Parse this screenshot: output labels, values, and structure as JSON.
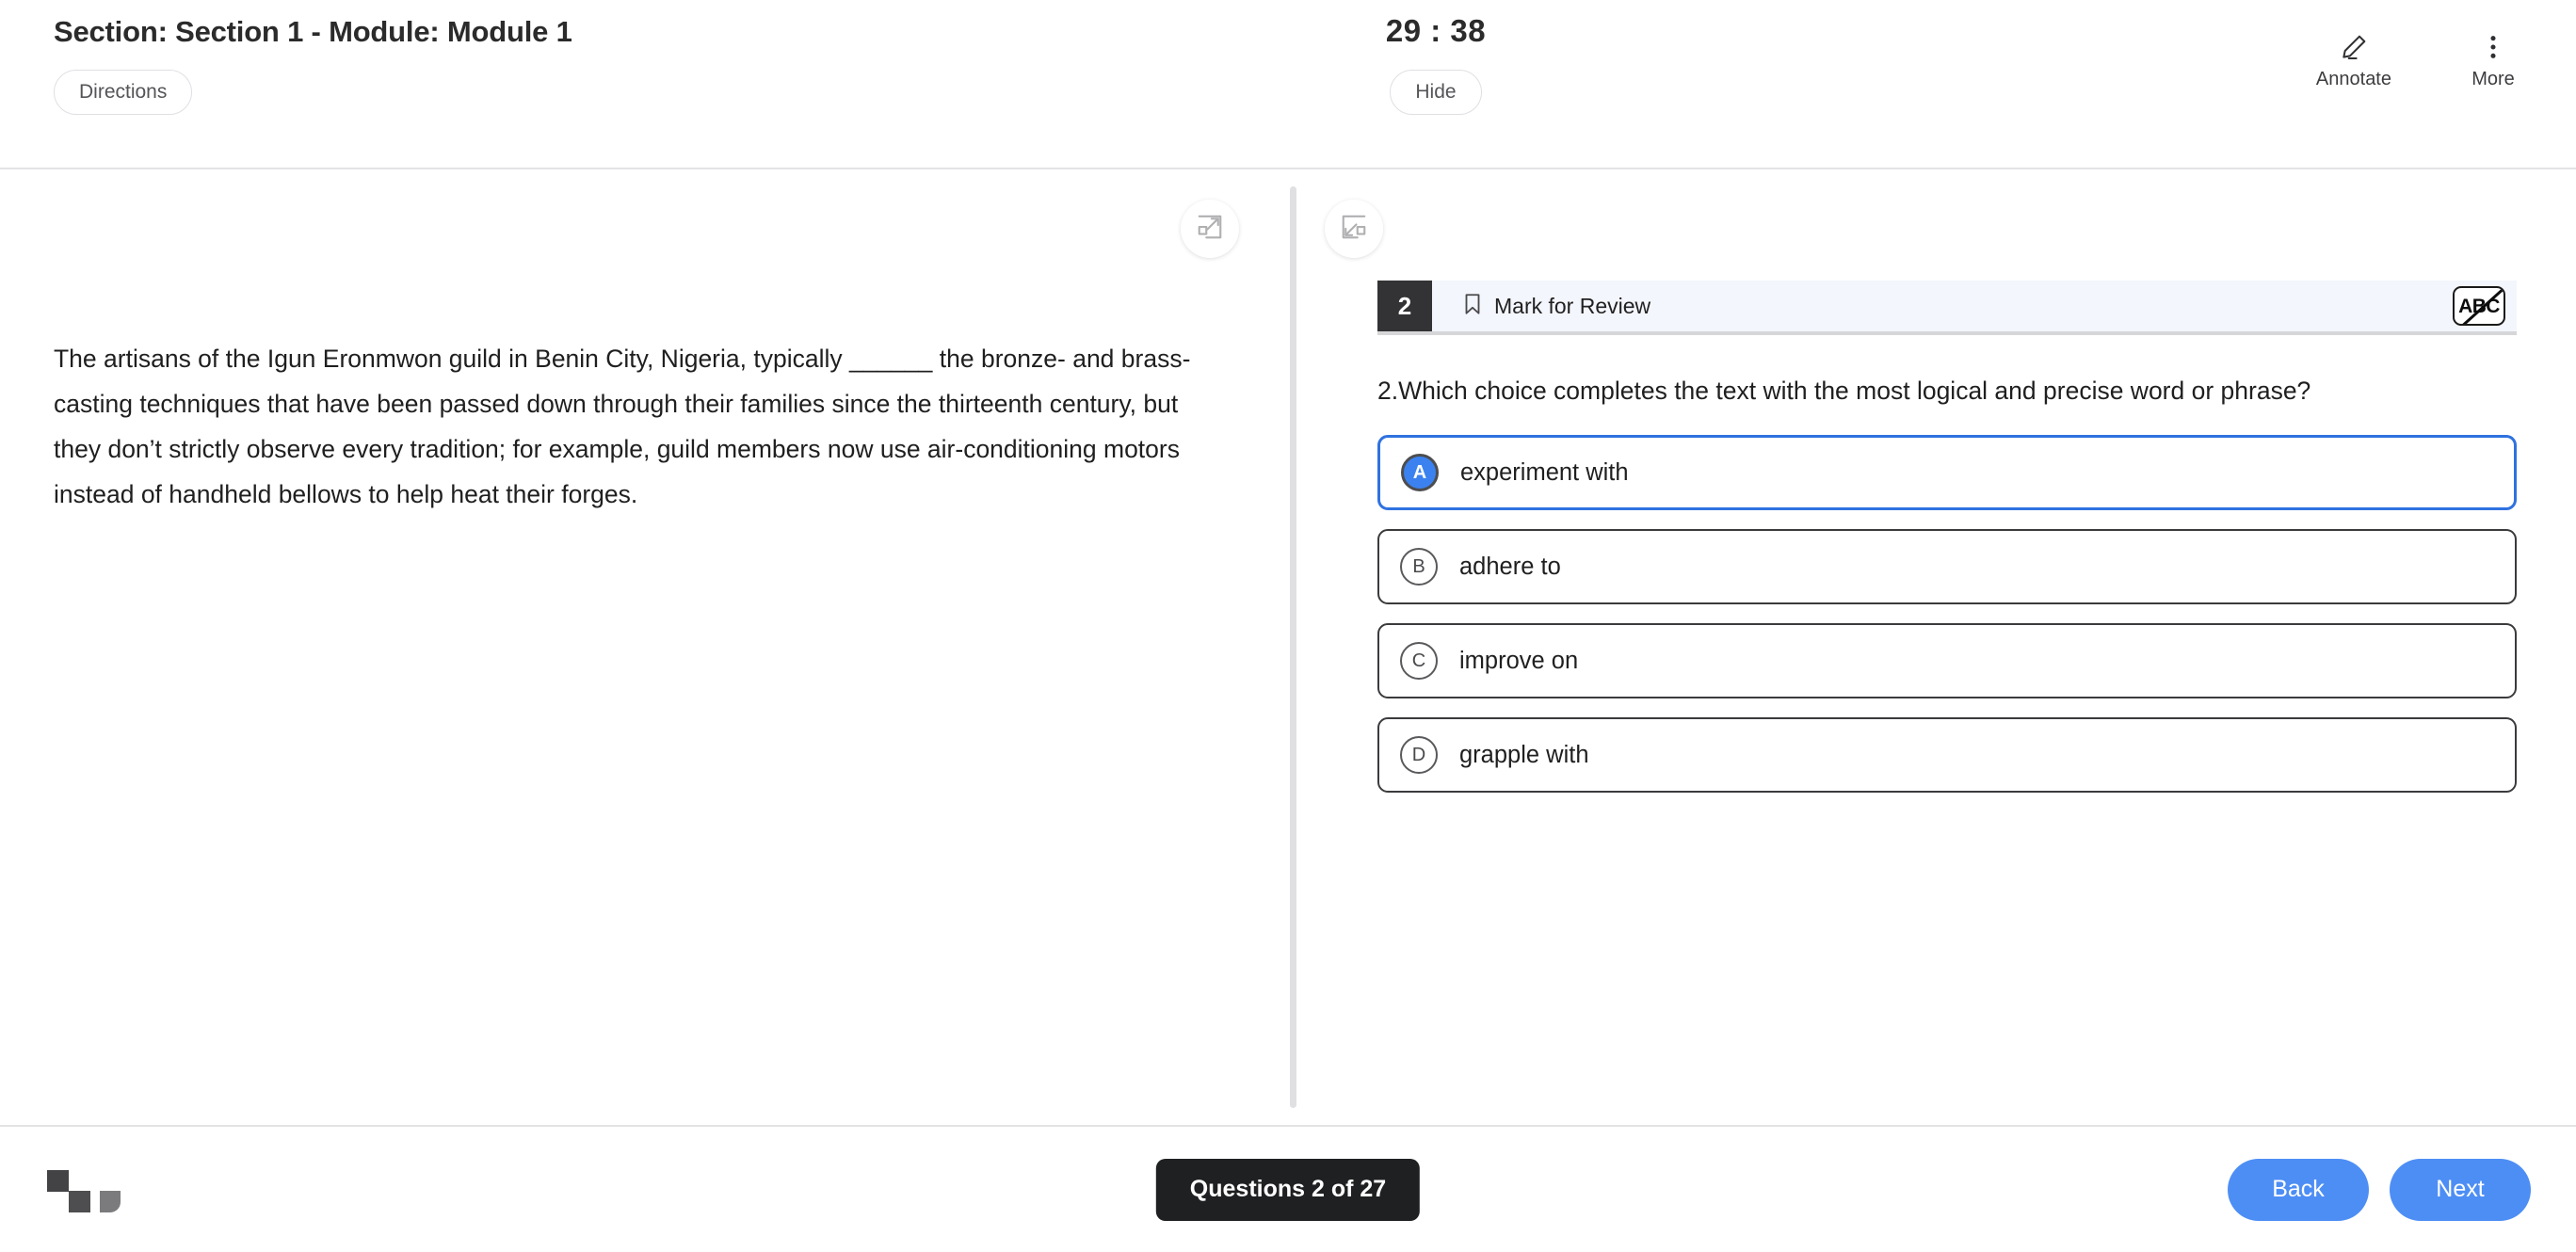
{
  "header": {
    "section_title": "Section: Section 1 - Module: Module 1",
    "directions_label": "Directions",
    "timer": "29 : 38",
    "hide_label": "Hide",
    "annotate_label": "Annotate",
    "more_label": "More"
  },
  "passage": {
    "part1": "The artisans of the Igun Eronmwon guild in Benin City, Nigeria, typically ",
    "blank": "______",
    "part2": " the bronze- and brass-casting techniques that have been passed down through their families since the thirteenth century, but they don’t strictly observe every tradition; for example, guild members now use air-conditioning motors instead of handheld bellows to help heat their forges."
  },
  "question": {
    "number": "2",
    "mark_for_review_label": "Mark for Review",
    "abc_label": "ABC",
    "prompt": "2.Which choice completes the text with the most logical and precise word or phrase?",
    "choices": [
      {
        "letter": "A",
        "text": "experiment with",
        "selected": true
      },
      {
        "letter": "B",
        "text": "adhere to",
        "selected": false
      },
      {
        "letter": "C",
        "text": "improve on",
        "selected": false
      },
      {
        "letter": "D",
        "text": "grapple with",
        "selected": false
      }
    ]
  },
  "footer": {
    "questions_label": "Questions 2 of 27",
    "back_label": "Back",
    "next_label": "Next"
  },
  "colors": {
    "accent_blue": "#4d8ef5",
    "selected_blue": "#2f72e0",
    "q_header_bg": "#f4f6fd",
    "q_num_bg": "#333335",
    "dark_button": "#1f2021"
  }
}
